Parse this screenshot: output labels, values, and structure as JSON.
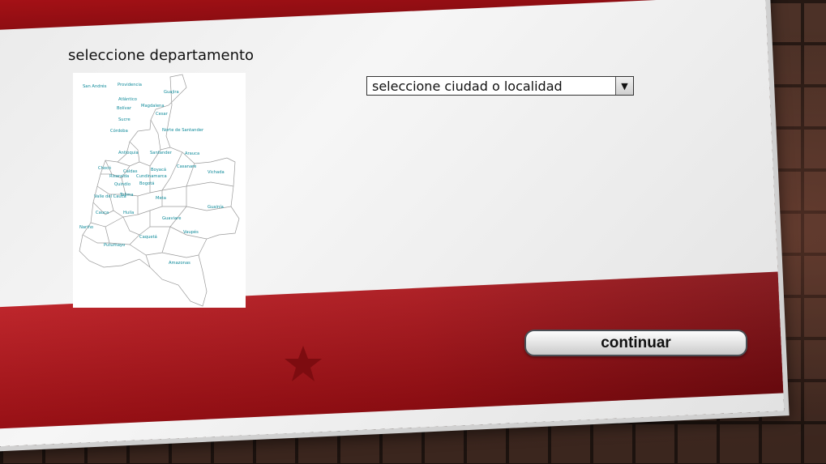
{
  "left_panel": {
    "title": "seleccione departamento",
    "map": {
      "regions": [
        "San Andrés",
        "Providencia",
        "Guajira",
        "Atlántico",
        "Magdalena",
        "Bolívar",
        "Cesar",
        "Sucre",
        "Norte de Santander",
        "Córdoba",
        "Antioquia",
        "Santander",
        "Arauca",
        "Chocó",
        "Caldas",
        "Boyacá",
        "Casanare",
        "Vichada",
        "Risaralda",
        "Cundinamarca",
        "Quindío",
        "Bogotá",
        "Valle del Cauca",
        "Tolima",
        "Meta",
        "Cauca",
        "Huila",
        "Guainía",
        "Guaviare",
        "Nariño",
        "Vaupés",
        "Caquetá",
        "Putumayo",
        "Amazonas"
      ]
    }
  },
  "city_select": {
    "selected": "seleccione ciudad o localidad",
    "arrow_icon": "triangle-down"
  },
  "continue_button": {
    "label": "continuar"
  },
  "decor": {
    "star_icon": "star",
    "accent_red": "#b01318",
    "star_color": "#7d0c10"
  }
}
